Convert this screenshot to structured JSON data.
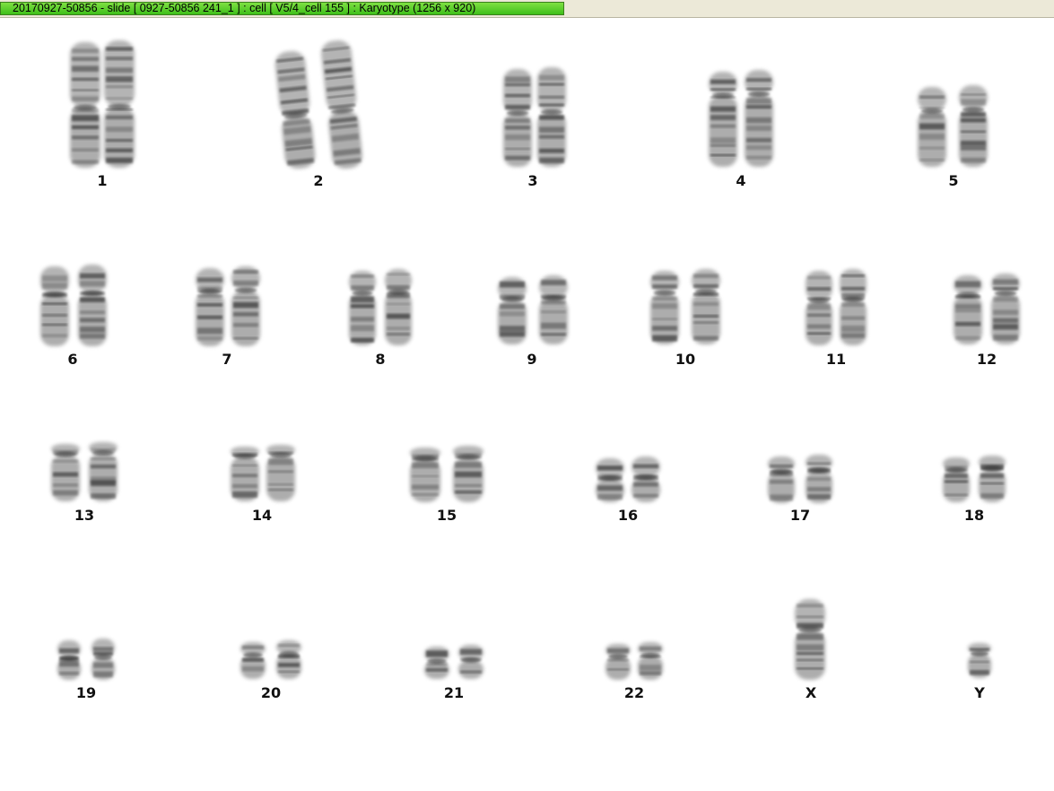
{
  "window": {
    "title": "20170927-50856 - slide [ 0927-50856 241_1 ] : cell [ V5/4_cell 155 ] : Karyotype  (1256 x 920)"
  },
  "karyotype": {
    "rows": [
      [
        "1",
        "2",
        "3",
        "4",
        "5"
      ],
      [
        "6",
        "7",
        "8",
        "9",
        "10",
        "11",
        "12"
      ],
      [
        "13",
        "14",
        "15",
        "16",
        "17",
        "18"
      ],
      [
        "19",
        "20",
        "21",
        "22",
        "X",
        "Y"
      ]
    ],
    "chromosome_color": "#777777"
  }
}
